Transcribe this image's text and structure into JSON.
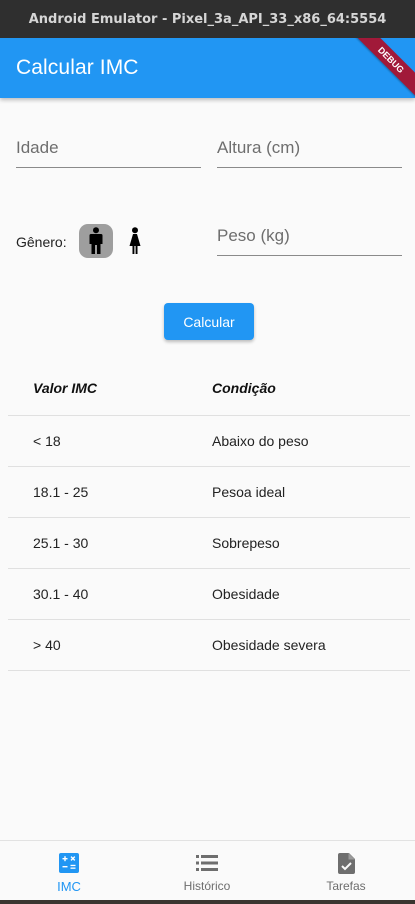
{
  "window": {
    "title": "Android Emulator - Pixel_3a_API_33_x86_64:5554"
  },
  "appbar": {
    "title": "Calcular IMC",
    "debug_label": "DEBUG"
  },
  "form": {
    "idade_placeholder": "Idade",
    "altura_placeholder": "Altura (cm)",
    "peso_placeholder": "Peso (kg)",
    "genero_label": "Gênero:",
    "gender_selected": "male",
    "calc_button": "Calcular"
  },
  "table": {
    "headers": [
      "Valor IMC",
      "Condição"
    ],
    "rows": [
      [
        "< 18",
        "Abaixo do peso"
      ],
      [
        "18.1 - 25",
        "Pesoa ideal"
      ],
      [
        "25.1 - 30",
        "Sobrepeso"
      ],
      [
        "30.1 - 40",
        "Obesidade"
      ],
      [
        "> 40",
        "Obesidade severa"
      ]
    ]
  },
  "nav": {
    "items": [
      {
        "label": "IMC",
        "icon": "calculator-icon",
        "active": true
      },
      {
        "label": "Histórico",
        "icon": "list-icon",
        "active": false
      },
      {
        "label": "Tarefas",
        "icon": "task-document-icon",
        "active": false
      }
    ]
  },
  "colors": {
    "primary": "#2196f3",
    "debug": "#a11939",
    "selected_gender_bg": "#9e9e9e"
  }
}
